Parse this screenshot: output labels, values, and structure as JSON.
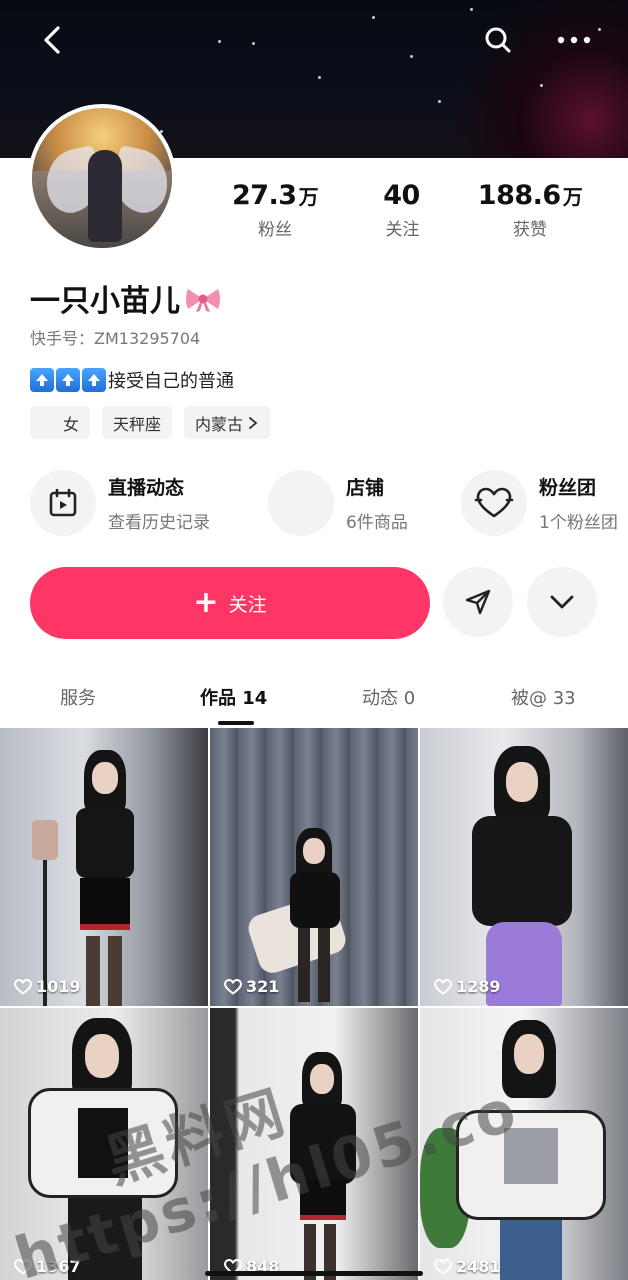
{
  "profile": {
    "nickname": "一只小苗儿",
    "nickname_emoji": "bow-emoji",
    "uid_label": "快手号：",
    "uid": "ZM13295704",
    "bio_icons": [
      "up-arrow-emoji",
      "up-arrow-emoji",
      "up-arrow-emoji"
    ],
    "bio_text": "接受自己的普通"
  },
  "stats": [
    {
      "value": "27.3",
      "unit": "万",
      "label": "粉丝"
    },
    {
      "value": "40",
      "unit": "",
      "label": "关注"
    },
    {
      "value": "188.6",
      "unit": "万",
      "label": "获赞"
    }
  ],
  "tags": [
    {
      "label": "女",
      "icon": "female-icon"
    },
    {
      "label": "天秤座"
    },
    {
      "label": "内蒙古",
      "icon": "chevron-right-icon"
    }
  ],
  "features": [
    {
      "title": "直播动态",
      "subtitle": "查看历史记录",
      "icon": "calendar-play-icon"
    },
    {
      "title": "店铺",
      "subtitle": "6件商品",
      "icon": "shop-icon"
    },
    {
      "title": "粉丝团",
      "subtitle": "1个粉丝团",
      "icon": "heart-icon"
    }
  ],
  "actions": {
    "follow_label": "关注"
  },
  "tabs": [
    {
      "label": "服务"
    },
    {
      "label": "作品 14",
      "active": true
    },
    {
      "label": "动态 0"
    },
    {
      "label": "被@ 33"
    }
  ],
  "posts": [
    {
      "likes": "1019"
    },
    {
      "likes": "321"
    },
    {
      "likes": "1289"
    },
    {
      "likes": "1367"
    },
    {
      "likes": "848"
    },
    {
      "likes": "2481"
    }
  ],
  "watermark": {
    "line1": "黑料网",
    "line2": "https://hl05.co"
  },
  "colors": {
    "accent": "#fe3666",
    "banner": "#0b0f1a"
  }
}
